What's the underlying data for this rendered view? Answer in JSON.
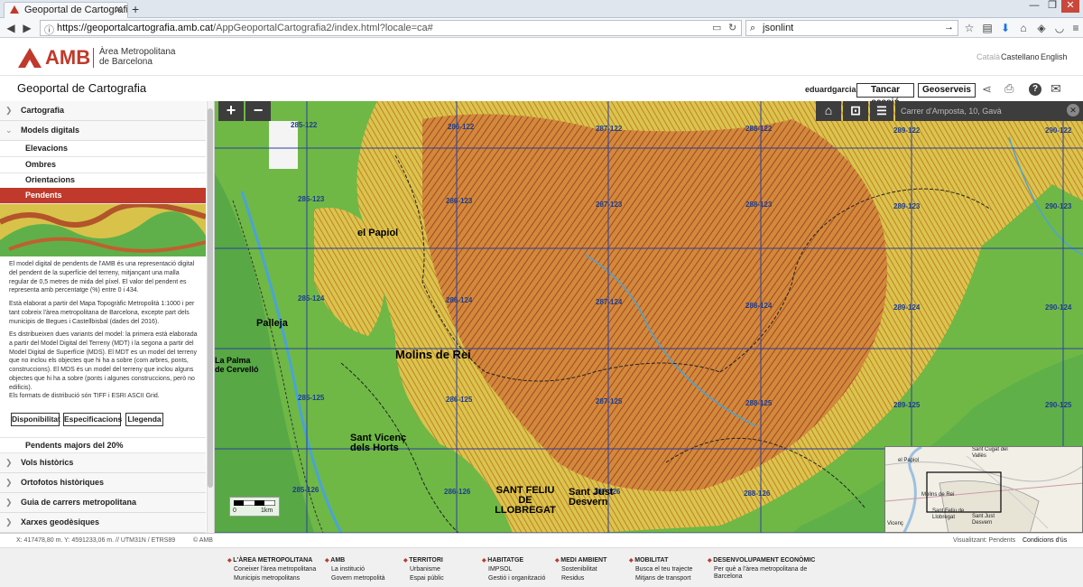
{
  "browser": {
    "tab_title": "Geoportal de Cartografia v...",
    "url_host": "https://geoportalcartografia.amb.cat",
    "url_path": "/AppGeoportalCartografia2/index.html?locale=ca#",
    "search_value": "jsonlint"
  },
  "header": {
    "logo_text": "AMB",
    "org_line1": "Àrea Metropolitana",
    "org_line2": "de Barcelona",
    "languages": [
      "Català",
      "Castellano",
      "English"
    ],
    "app_title": "Geoportal de Cartografia",
    "username": "eduardgarcia",
    "logout_label": "Tancar sessió",
    "geoserveis_label": "Geoserveis"
  },
  "sidebar": {
    "sections": [
      "Cartografia",
      "Models digitals"
    ],
    "subitems": [
      "Elevacions",
      "Ombres",
      "Orientacions",
      "Pendents"
    ],
    "description": [
      "El model digital de pendents de l'AMB és una representació digital del pendent de la superfície del terreny, mitjançant una malla regular de 0,5 metres de mida del píxel. El valor del pendent es representa amb percentatge (%) entre 0 i 434.",
      "Està elaborat a partir del Mapa Topogràfic Metropolità 1:1000 i per tant cobreix l'àrea metropolitana de Barcelona, excepte part dels municipis de Begues i Castellbisbal (dades del 2016).",
      "Es distribueixen dues variants del model: la primera està elaborada a partir del Model Digital del Terreny (MDT) i la segona a partir del Model Digital de Superfície (MDS). El MDT es un model del terreny que no inclou els objectes que hi ha a sobre (com arbres, ponts, construccions). El MDS és un model del terreny que inclou alguns objectes que hi ha a sobre (ponts i algunes construccions, però no edificis).",
      "Els formats de distribució són TIFF i ESRI ASCII Grid."
    ],
    "buttons": [
      "Disponibilitat",
      "Especificacions",
      "Llegenda"
    ],
    "extra_item": "Pendents majors del 20%",
    "more_sections": [
      "Vols històrics",
      "Ortofotos històriques",
      "Guia de carrers metropolitana",
      "Xarxes geodèsiques"
    ]
  },
  "map": {
    "search_placeholder": "Carrer d'Amposta, 10, Gavà",
    "tiles": [
      "285-122",
      "286-122",
      "287-122",
      "288-122",
      "289-122",
      "290-122",
      "285-123",
      "286-123",
      "287-123",
      "288-123",
      "289-123",
      "290-123",
      "285-124",
      "286-124",
      "287-124",
      "288-124",
      "289-124",
      "290-124",
      "285-125",
      "286-125",
      "287-125",
      "288-125",
      "289-125",
      "290-125",
      "285-126",
      "286-126",
      "287-126",
      "288-126"
    ],
    "towns": [
      "el Papiol",
      "Palleja",
      "Molins de Rei",
      "La Palma de Cervelló",
      "Sant Vicenç dels Horts",
      "SANT FELIU DE LLOBREGAT",
      "Sant Just Desvern"
    ],
    "scale_labels": [
      "0",
      "1km"
    ],
    "minimap_labels": [
      "Sant Cugat del Vallès",
      "el Papiol",
      "Molins de Rei",
      "Sant Feliu de Llobregat",
      "Sant Just Desvern",
      "Vicenç"
    ]
  },
  "status": {
    "coords": "X: 417478,80 m. Y: 4591233,06 m. // UTM31N / ETRS89",
    "copyright": "© AMB",
    "viewing": "Visualitzant: Pendents",
    "conditions": "Condicions d'ús"
  },
  "footer": [
    {
      "heading": "L'ÀREA METROPOLITANA",
      "links": [
        "Coneixer l'àrea metropolitana",
        "Municipis metropolitans"
      ]
    },
    {
      "heading": "AMB",
      "links": [
        "La institució",
        "Govern metropolità"
      ]
    },
    {
      "heading": "TERRITORI",
      "links": [
        "Urbanisme",
        "Espai públic"
      ]
    },
    {
      "heading": "HABITATGE",
      "links": [
        "IMPSOL",
        "Gestió i organització"
      ]
    },
    {
      "heading": "MEDI AMBIENT",
      "links": [
        "Sostenibilitat",
        "Residus"
      ]
    },
    {
      "heading": "MOBILITAT",
      "links": [
        "Busca el teu trajecte",
        "Mitjans de transport"
      ]
    },
    {
      "heading": "DESENVOLUPAMENT ECONÒMIC",
      "links": [
        "Per què a l'àrea metropolitana de Barcelona"
      ]
    }
  ],
  "colors": {
    "brand_red": "#c0392b",
    "map_control_bg": "#3d3d3d",
    "slope_low": "#4caf50",
    "slope_mid": "#e8e44a",
    "slope_high": "#c0502a"
  }
}
